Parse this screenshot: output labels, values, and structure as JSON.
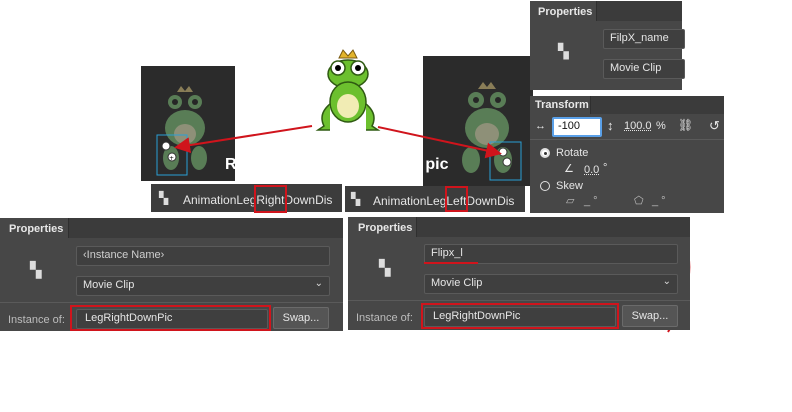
{
  "colors": {
    "accent_red": "#d0141c",
    "panel_bg": "#474747",
    "field_bg": "#3f3f3f",
    "selection_blue": "#2a9fd6"
  },
  "overlay": {
    "left_label_fragment": "R",
    "right_label_fragment": "e pic"
  },
  "left_stage": {
    "symbol_path": "AnimationLegRightDownDis"
  },
  "right_stage": {
    "symbol_path": "AnimationLegLeftDownDis"
  },
  "top_props": {
    "title": "Properties",
    "instance_name": "FilpX_name",
    "type_value": "Movie Clip"
  },
  "transform": {
    "title": "Transform",
    "width_value": "-100",
    "height_value": "100.0",
    "height_unit": "%",
    "rotate_label": "Rotate",
    "rotate_value": "0.0",
    "rotate_unit": "°",
    "skew_label": "Skew",
    "skew_x": "_ °",
    "skew_y": "_ °"
  },
  "left_props": {
    "title": "Properties",
    "instance_placeholder": "‹Instance Name›",
    "type_value": "Movie Clip",
    "instance_of_label": "Instance of:",
    "instance_of_value": "LegRightDownPic",
    "swap_label": "Swap..."
  },
  "right_props": {
    "title": "Properties",
    "instance_name": "Flipx_l",
    "type_value": "Movie Clip",
    "instance_of_label": "Instance of:",
    "instance_of_value": "LegRightDownPic",
    "swap_label": "Swap..."
  },
  "icons": {
    "symbol": "movie-clip-symbol-icon",
    "dropdown": "chevron-down-icon",
    "link": "link-icon",
    "reset": "reset-transform-icon",
    "frog": "frog-character-image"
  }
}
